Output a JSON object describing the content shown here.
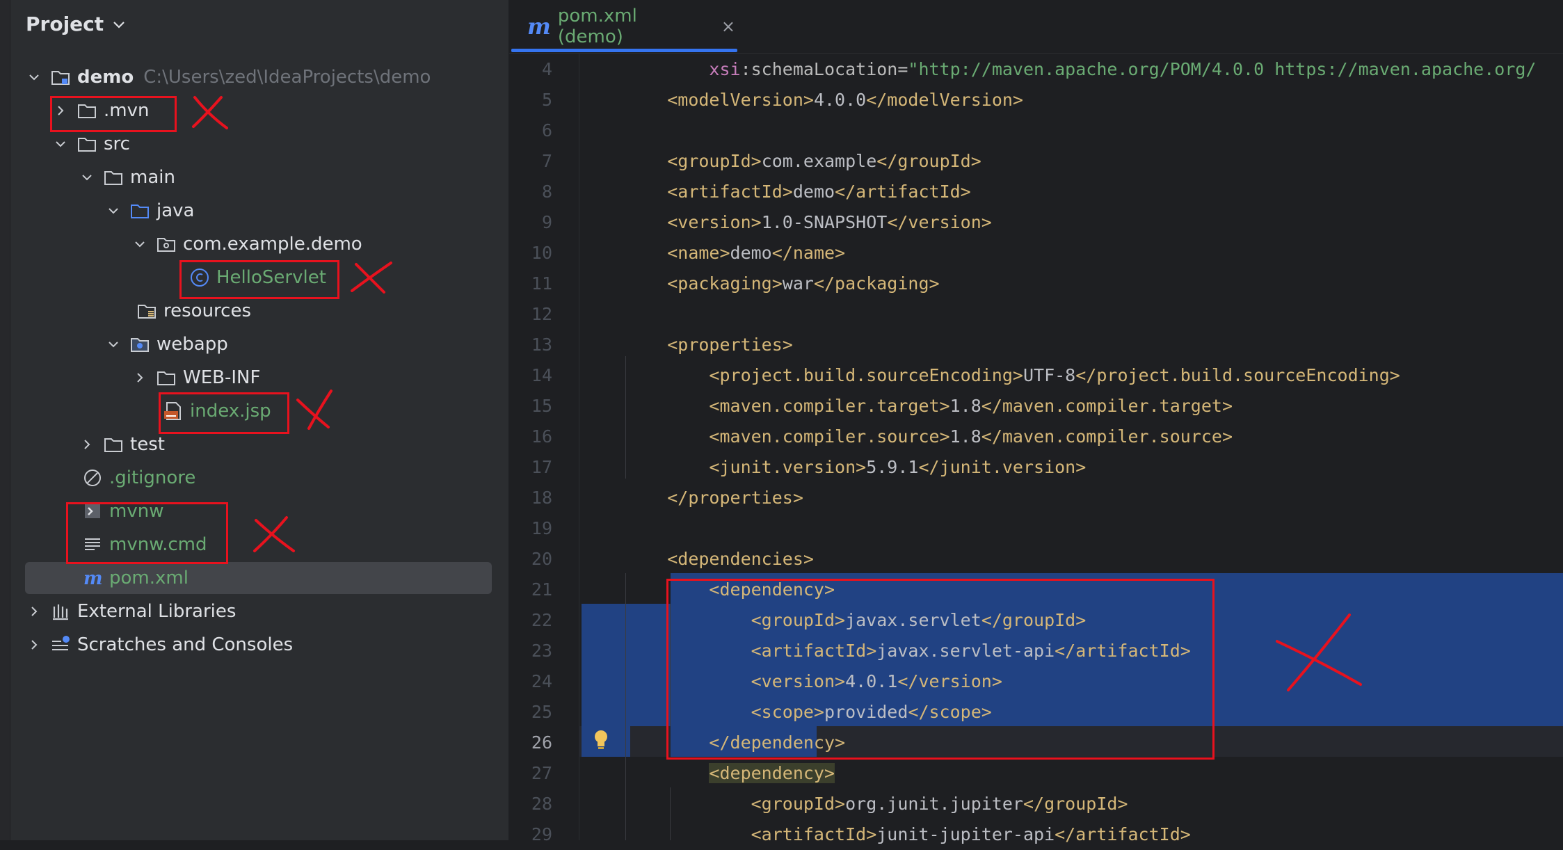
{
  "project_panel": {
    "title": "Project",
    "tree": [
      {
        "label": "demo",
        "path": "C:\\Users\\zed\\IdeaProjects\\demo"
      },
      {
        "label": ".mvn"
      },
      {
        "label": "src"
      },
      {
        "label": "main"
      },
      {
        "label": "java"
      },
      {
        "label": "com.example.demo"
      },
      {
        "label": "HelloServlet"
      },
      {
        "label": "resources"
      },
      {
        "label": "webapp"
      },
      {
        "label": "WEB-INF"
      },
      {
        "label": "index.jsp"
      },
      {
        "label": "test"
      },
      {
        "label": ".gitignore"
      },
      {
        "label": "mvnw"
      },
      {
        "label": "mvnw.cmd"
      },
      {
        "label": "pom.xml"
      },
      {
        "label": "External Libraries"
      },
      {
        "label": "Scratches and Consoles"
      }
    ]
  },
  "editor": {
    "tab": {
      "icon": "m",
      "label": "pom.xml (demo)",
      "close": "×"
    },
    "lines": [
      {
        "n": "4",
        "ind": "        ",
        "p": [
          "",
          "xsi",
          ":schemaLocation=",
          "\"http://maven.apache.org/POM/4.0.0 https://maven.apache.org/",
          "",
          "",
          ""
        ]
      },
      {
        "n": "5",
        "ind": "    ",
        "p": [
          "<modelVersion>",
          "4.0.0",
          "</modelVersion>"
        ]
      },
      {
        "n": "6",
        "ind": "",
        "p": [
          "",
          "",
          ""
        ]
      },
      {
        "n": "7",
        "ind": "    ",
        "p": [
          "<groupId>",
          "com.example",
          "</groupId>"
        ]
      },
      {
        "n": "8",
        "ind": "    ",
        "p": [
          "<artifactId>",
          "demo",
          "</artifactId>"
        ]
      },
      {
        "n": "9",
        "ind": "    ",
        "p": [
          "<version>",
          "1.0-SNAPSHOT",
          "</version>"
        ]
      },
      {
        "n": "10",
        "ind": "    ",
        "p": [
          "<name>",
          "demo",
          "</name>"
        ]
      },
      {
        "n": "11",
        "ind": "    ",
        "p": [
          "<packaging>",
          "war",
          "</packaging>"
        ]
      },
      {
        "n": "12",
        "ind": "",
        "p": [
          "",
          "",
          ""
        ]
      },
      {
        "n": "13",
        "ind": "    ",
        "p": [
          "<properties>",
          "",
          ""
        ]
      },
      {
        "n": "14",
        "ind": "        ",
        "p": [
          "<project.build.sourceEncoding>",
          "UTF-8",
          "</project.build.sourceEncoding>"
        ]
      },
      {
        "n": "15",
        "ind": "        ",
        "p": [
          "<maven.compiler.target>",
          "1.8",
          "</maven.compiler.target>"
        ]
      },
      {
        "n": "16",
        "ind": "        ",
        "p": [
          "<maven.compiler.source>",
          "1.8",
          "</maven.compiler.source>"
        ]
      },
      {
        "n": "17",
        "ind": "        ",
        "p": [
          "<junit.version>",
          "5.9.1",
          "</junit.version>"
        ]
      },
      {
        "n": "18",
        "ind": "    ",
        "p": [
          "</properties>",
          "",
          ""
        ]
      },
      {
        "n": "19",
        "ind": "",
        "p": [
          "",
          "",
          ""
        ]
      },
      {
        "n": "20",
        "ind": "    ",
        "p": [
          "<dependencies>",
          "",
          ""
        ]
      },
      {
        "n": "21",
        "ind": "        ",
        "p": [
          "<dependency>",
          "",
          ""
        ]
      },
      {
        "n": "22",
        "ind": "            ",
        "p": [
          "<groupId>",
          "javax.servlet",
          "</groupId>"
        ]
      },
      {
        "n": "23",
        "ind": "            ",
        "p": [
          "<artifactId>",
          "javax.servlet-api",
          "</artifactId>"
        ]
      },
      {
        "n": "24",
        "ind": "            ",
        "p": [
          "<version>",
          "4.0.1",
          "</version>"
        ]
      },
      {
        "n": "25",
        "ind": "            ",
        "p": [
          "<scope>",
          "provided",
          "</scope>"
        ]
      },
      {
        "n": "26",
        "ind": "        ",
        "p": [
          "</dependency>",
          "",
          ""
        ]
      },
      {
        "n": "27",
        "ind": "        ",
        "p": [
          "<dependency>",
          "",
          ""
        ]
      },
      {
        "n": "28",
        "ind": "            ",
        "p": [
          "<groupId>",
          "org.junit.jupiter",
          "</groupId>"
        ]
      },
      {
        "n": "29",
        "ind": "            ",
        "p": [
          "<artifactId>",
          "junit-jupiter-api",
          "</artifactId>"
        ]
      }
    ]
  },
  "colors": {
    "accent": "#3574f0",
    "selection": "#214283",
    "annotation_red": "#e8121e",
    "green_file": "#6aab73",
    "tag": "#d5b778"
  }
}
